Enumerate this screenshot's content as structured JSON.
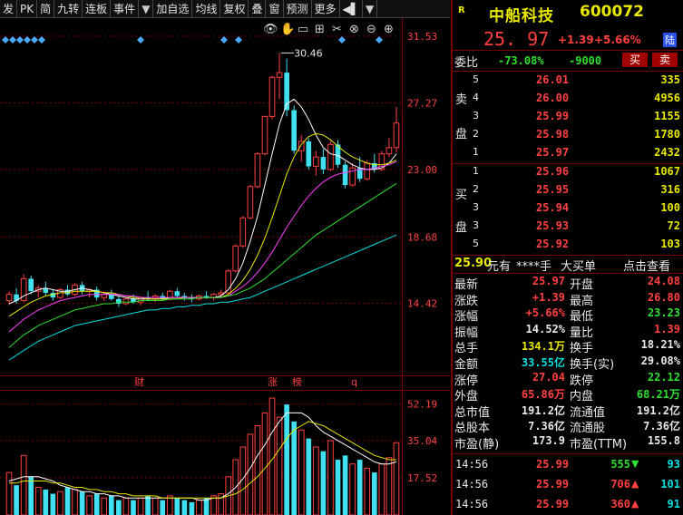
{
  "toolbar": {
    "items": [
      "发",
      "PK",
      "简",
      "九转",
      "连板",
      "事件",
      "▼",
      "加自选",
      "均线",
      "复权",
      "叠",
      "窗",
      "预测",
      "更多",
      "◀▌",
      "▼"
    ]
  },
  "chart_data": [
    {
      "type": "candlestick",
      "y_ticks": [
        "31.53",
        "27.27",
        "23.00",
        "18.68",
        "14.42"
      ],
      "ylim": [
        10.16,
        31.53
      ],
      "high_marker": "30.46",
      "event_labels": [
        "财",
        "涨",
        "榜",
        "q"
      ],
      "candles": [
        [
          14.6,
          15.2,
          14.3,
          15.0
        ],
        [
          15.0,
          15.4,
          14.4,
          14.6
        ],
        [
          14.6,
          16.3,
          14.5,
          16.0
        ],
        [
          16.0,
          16.2,
          15.0,
          15.2
        ],
        [
          15.2,
          15.6,
          14.8,
          15.4
        ],
        [
          15.4,
          15.8,
          14.9,
          15.1
        ],
        [
          15.1,
          15.3,
          14.6,
          14.8
        ],
        [
          14.8,
          15.4,
          14.7,
          15.3
        ],
        [
          15.3,
          15.6,
          14.9,
          15.0
        ],
        [
          15.0,
          15.7,
          14.9,
          15.6
        ],
        [
          15.6,
          15.8,
          15.0,
          15.2
        ],
        [
          15.2,
          15.4,
          14.8,
          15.3
        ],
        [
          15.3,
          15.5,
          14.6,
          14.8
        ],
        [
          14.8,
          15.2,
          14.6,
          15.0
        ],
        [
          15.0,
          15.3,
          14.6,
          14.7
        ],
        [
          14.7,
          14.9,
          14.2,
          14.4
        ],
        [
          14.4,
          14.8,
          14.3,
          14.7
        ],
        [
          14.7,
          15.0,
          14.4,
          14.5
        ],
        [
          14.5,
          14.9,
          14.3,
          14.8
        ],
        [
          14.8,
          15.2,
          14.6,
          14.7
        ],
        [
          14.7,
          15.0,
          14.5,
          14.9
        ],
        [
          14.9,
          15.1,
          14.6,
          14.7
        ],
        [
          14.7,
          15.3,
          14.6,
          15.2
        ],
        [
          15.2,
          15.4,
          14.8,
          14.9
        ],
        [
          14.9,
          15.1,
          14.6,
          14.8
        ],
        [
          14.8,
          15.0,
          14.5,
          14.7
        ],
        [
          14.7,
          15.0,
          14.6,
          14.9
        ],
        [
          14.9,
          15.2,
          14.7,
          14.8
        ],
        [
          14.8,
          15.1,
          14.6,
          15.0
        ],
        [
          15.0,
          15.3,
          14.8,
          15.1
        ],
        [
          15.1,
          16.6,
          15.0,
          16.5
        ],
        [
          16.5,
          18.2,
          16.4,
          18.1
        ],
        [
          18.1,
          20.0,
          18.0,
          19.9
        ],
        [
          19.9,
          22.0,
          19.8,
          21.9
        ],
        [
          21.9,
          24.1,
          21.8,
          24.0
        ],
        [
          24.0,
          26.4,
          23.9,
          26.4
        ],
        [
          26.4,
          29.0,
          26.2,
          28.9
        ],
        [
          28.9,
          30.46,
          27.5,
          29.2
        ],
        [
          29.2,
          30.1,
          26.4,
          26.8
        ],
        [
          26.8,
          27.1,
          24.0,
          24.2
        ],
        [
          24.2,
          25.2,
          23.5,
          24.8
        ],
        [
          24.8,
          25.0,
          23.0,
          23.2
        ],
        [
          23.2,
          24.2,
          22.6,
          23.8
        ],
        [
          23.8,
          24.3,
          22.7,
          23.0
        ],
        [
          23.0,
          24.8,
          22.9,
          24.6
        ],
        [
          24.6,
          24.9,
          23.1,
          23.3
        ],
        [
          23.3,
          23.5,
          21.8,
          22.0
        ],
        [
          22.0,
          23.4,
          21.9,
          23.1
        ],
        [
          23.1,
          23.8,
          22.2,
          22.4
        ],
        [
          22.4,
          23.6,
          22.3,
          23.4
        ],
        [
          23.4,
          24.0,
          22.8,
          23.0
        ],
        [
          23.0,
          24.2,
          22.9,
          24.0
        ],
        [
          24.0,
          25.0,
          23.8,
          24.4
        ],
        [
          24.4,
          27.0,
          24.1,
          25.97
        ]
      ],
      "ma_lines": [
        {
          "color": "#ffffff",
          "values": [
            14.4,
            14.6,
            14.9,
            15.1,
            15.3,
            15.4,
            15.3,
            15.2,
            15.2,
            15.3,
            15.4,
            15.3,
            15.2,
            15.1,
            15.0,
            14.9,
            14.8,
            14.7,
            14.7,
            14.7,
            14.7,
            14.7,
            14.8,
            14.8,
            14.8,
            14.8,
            14.8,
            14.8,
            14.8,
            14.9,
            15.3,
            16.0,
            17.0,
            18.4,
            20.0,
            22.0,
            24.0,
            25.9,
            27.2,
            27.5,
            27.0,
            26.2,
            25.2,
            24.4,
            24.0,
            23.9,
            23.6,
            23.3,
            23.1,
            23.0,
            23.0,
            23.1,
            23.4,
            24.0
          ]
        },
        {
          "color": "#e8e800",
          "values": [
            13.6,
            13.9,
            14.2,
            14.5,
            14.7,
            14.9,
            15.0,
            15.1,
            15.1,
            15.2,
            15.2,
            15.2,
            15.2,
            15.1,
            15.1,
            15.0,
            14.9,
            14.8,
            14.8,
            14.7,
            14.7,
            14.7,
            14.7,
            14.7,
            14.8,
            14.8,
            14.8,
            14.8,
            14.8,
            14.8,
            15.0,
            15.4,
            15.9,
            16.6,
            17.5,
            18.6,
            19.9,
            21.3,
            22.7,
            23.8,
            24.6,
            25.1,
            25.3,
            25.2,
            24.9,
            24.5,
            24.1,
            23.8,
            23.6,
            23.4,
            23.3,
            23.3,
            23.4,
            23.6
          ]
        },
        {
          "color": "#ff40ff",
          "values": [
            12.6,
            13.0,
            13.4,
            13.7,
            14.0,
            14.2,
            14.4,
            14.6,
            14.7,
            14.8,
            14.9,
            15.0,
            15.0,
            15.0,
            15.0,
            15.0,
            14.9,
            14.9,
            14.8,
            14.8,
            14.8,
            14.8,
            14.8,
            14.8,
            14.8,
            14.8,
            14.8,
            14.8,
            14.8,
            14.8,
            14.9,
            15.2,
            15.5,
            15.9,
            16.4,
            17.0,
            17.7,
            18.5,
            19.3,
            20.0,
            20.7,
            21.3,
            21.8,
            22.2,
            22.5,
            22.7,
            22.8,
            22.9,
            23.0,
            23.0,
            23.1,
            23.2,
            23.3,
            23.5
          ]
        },
        {
          "color": "#2ee02e",
          "values": [
            11.6,
            12.0,
            12.4,
            12.7,
            13.0,
            13.2,
            13.4,
            13.6,
            13.8,
            14.0,
            14.1,
            14.2,
            14.3,
            14.4,
            14.4,
            14.5,
            14.5,
            14.5,
            14.6,
            14.6,
            14.6,
            14.6,
            14.7,
            14.7,
            14.7,
            14.7,
            14.8,
            14.8,
            14.8,
            14.8,
            14.9,
            15.0,
            15.2,
            15.4,
            15.7,
            16.0,
            16.4,
            16.8,
            17.2,
            17.6,
            18.0,
            18.4,
            18.8,
            19.1,
            19.4,
            19.7,
            20.0,
            20.3,
            20.6,
            20.9,
            21.2,
            21.5,
            21.8,
            22.1
          ]
        },
        {
          "color": "#00e0e0",
          "values": [
            10.8,
            11.1,
            11.4,
            11.7,
            12.0,
            12.2,
            12.4,
            12.6,
            12.8,
            13.0,
            13.1,
            13.2,
            13.3,
            13.4,
            13.5,
            13.6,
            13.7,
            13.8,
            13.9,
            14.0,
            14.0,
            14.1,
            14.1,
            14.2,
            14.2,
            14.3,
            14.3,
            14.4,
            14.4,
            14.5,
            14.5,
            14.6,
            14.7,
            14.8,
            15.0,
            15.2,
            15.4,
            15.6,
            15.8,
            16.0,
            16.2,
            16.4,
            16.6,
            16.8,
            17.0,
            17.2,
            17.4,
            17.6,
            17.8,
            18.0,
            18.2,
            18.4,
            18.6,
            18.8
          ]
        }
      ]
    },
    {
      "type": "bar",
      "y_ticks": [
        "52.19",
        "35.04",
        "17.52"
      ],
      "ylim": [
        0,
        58
      ],
      "volumes": [
        20,
        14,
        28,
        18,
        13,
        12,
        10,
        11,
        13,
        12,
        11,
        9,
        10,
        8,
        9,
        7,
        8,
        7,
        8,
        9,
        8,
        7,
        9,
        8,
        7,
        6,
        7,
        8,
        9,
        10,
        18,
        26,
        32,
        38,
        42,
        48,
        55,
        46,
        52,
        44,
        40,
        36,
        32,
        30,
        35,
        26,
        28,
        24,
        26,
        22,
        20,
        24,
        27,
        34
      ],
      "ma_lines": [
        {
          "color": "#ffffff",
          "values": [
            16,
            17,
            18,
            18,
            18,
            17,
            16,
            14,
            13,
            12,
            11,
            11,
            10,
            10,
            9,
            9,
            8,
            8,
            8,
            8,
            8,
            8,
            8,
            8,
            8,
            8,
            7,
            7,
            8,
            8,
            10,
            13,
            17,
            22,
            28,
            33,
            39,
            44,
            48,
            48,
            48,
            46,
            42,
            39,
            37,
            35,
            33,
            31,
            29,
            27,
            25,
            24,
            24,
            25
          ]
        },
        {
          "color": "#e8e800",
          "values": [
            15,
            15,
            16,
            16,
            16,
            16,
            15,
            15,
            14,
            13,
            13,
            12,
            12,
            11,
            11,
            10,
            10,
            9,
            9,
            9,
            9,
            8,
            8,
            8,
            8,
            8,
            8,
            8,
            8,
            8,
            9,
            10,
            12,
            15,
            18,
            22,
            26,
            31,
            36,
            40,
            42,
            44,
            43,
            42,
            40,
            38,
            36,
            34,
            32,
            30,
            28,
            27,
            26,
            26
          ]
        }
      ]
    }
  ],
  "quote": {
    "r_mark": "R",
    "name": "中船科技",
    "code": "600072",
    "price": "25. 97",
    "change": "+1.39",
    "change_pct": "+5.66%",
    "market_badge": "陆",
    "weibi_label": "委比",
    "weibi_pct": "-73.08%",
    "weibi_diff": "-9000",
    "buy_btn": "买",
    "sell_btn": "卖",
    "sell_side_label": [
      "卖",
      "盘"
    ],
    "buy_side_label": [
      "买",
      "盘"
    ],
    "asks": [
      {
        "idx": "5",
        "price": "26.01",
        "vol": "335"
      },
      {
        "idx": "4",
        "price": "26.00",
        "vol": "4956"
      },
      {
        "idx": "3",
        "price": "25.99",
        "vol": "1155"
      },
      {
        "idx": "2",
        "price": "25.98",
        "vol": "1780"
      },
      {
        "idx": "1",
        "price": "25.97",
        "vol": "2432"
      }
    ],
    "bids": [
      {
        "idx": "1",
        "price": "25.96",
        "vol": "1067"
      },
      {
        "idx": "2",
        "price": "25.95",
        "vol": "316"
      },
      {
        "idx": "3",
        "price": "25.94",
        "vol": "100"
      },
      {
        "idx": "3",
        "price": "25.93",
        "vol": "72"
      },
      {
        "idx": "5",
        "price": "25.92",
        "vol": "103"
      }
    ],
    "promo": {
      "price": "25.90",
      "unit": "元有",
      "masked": "****手",
      "mid": "大买单",
      "link": "点击查看"
    },
    "stats": [
      {
        "l1": "最新",
        "v1": "25.97",
        "c1": "red",
        "l2": "开盘",
        "v2": "24.08",
        "c2": "red"
      },
      {
        "l1": "涨跌",
        "v1": "+1.39",
        "c1": "red",
        "l2": "最高",
        "v2": "26.80",
        "c2": "red"
      },
      {
        "l1": "涨幅",
        "v1": "+5.66%",
        "c1": "red",
        "l2": "最低",
        "v2": "23.23",
        "c2": "green"
      },
      {
        "l1": "振幅",
        "v1": "14.52%",
        "c1": "white",
        "l2": "量比",
        "v2": "1.39",
        "c2": "red"
      },
      {
        "l1": "总手",
        "v1": "134.1万",
        "c1": "yellow",
        "l2": "换手",
        "v2": "18.21%",
        "c2": "white"
      },
      {
        "l1": "金额",
        "v1": "33.55亿",
        "c1": "cyan",
        "l2": "换手(实)",
        "v2": "29.08%",
        "c2": "white"
      },
      {
        "l1": "涨停",
        "v1": "27.04",
        "c1": "red",
        "l2": "跌停",
        "v2": "22.12",
        "c2": "green"
      },
      {
        "l1": "外盘",
        "v1": "65.86万",
        "c1": "red",
        "l2": "内盘",
        "v2": "68.21万",
        "c2": "green"
      },
      {
        "l1": "总市值",
        "v1": "191.2亿",
        "c1": "white",
        "l2": "流通值",
        "v2": "191.2亿",
        "c2": "white"
      },
      {
        "l1": "总股本",
        "v1": "7.36亿",
        "c1": "white",
        "l2": "流通股",
        "v2": "7.36亿",
        "c2": "white"
      },
      {
        "l1": "市盈(静)",
        "v1": "173.9",
        "c1": "white",
        "l2": "市盈(TTM)",
        "v2": "155.8",
        "c2": "white"
      }
    ],
    "ticks": [
      {
        "time": "14:56",
        "price": "25.99",
        "vol": "555",
        "dir": "down",
        "n": "93"
      },
      {
        "time": "14:56",
        "price": "25.99",
        "vol": "706",
        "dir": "up",
        "n": "101"
      },
      {
        "time": "14:56",
        "price": "25.99",
        "vol": "360",
        "dir": "up",
        "n": "91"
      }
    ]
  }
}
